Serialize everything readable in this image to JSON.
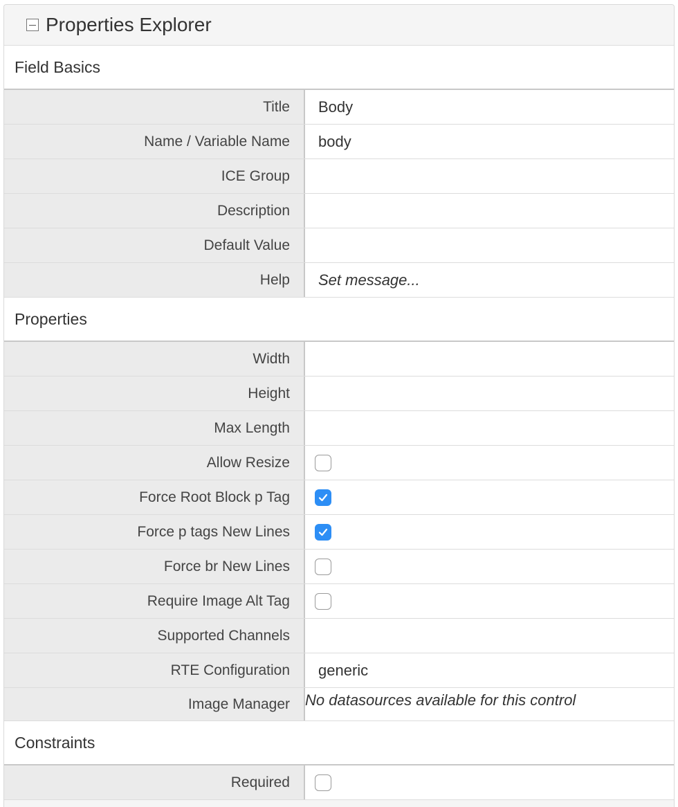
{
  "panel": {
    "title": "Properties Explorer"
  },
  "sections": {
    "field_basics": {
      "title": "Field Basics",
      "rows": [
        {
          "label": "Title",
          "value": "Body"
        },
        {
          "label": "Name / Variable Name",
          "value": "body"
        },
        {
          "label": "ICE Group",
          "value": ""
        },
        {
          "label": "Description",
          "value": ""
        },
        {
          "label": "Default Value",
          "value": ""
        },
        {
          "label": "Help",
          "value": "Set message..."
        }
      ]
    },
    "properties": {
      "title": "Properties",
      "rows": [
        {
          "label": "Width",
          "value": ""
        },
        {
          "label": "Height",
          "value": ""
        },
        {
          "label": "Max Length",
          "value": ""
        },
        {
          "label": "Allow Resize",
          "checked": false
        },
        {
          "label": "Force Root Block p Tag",
          "checked": true
        },
        {
          "label": "Force p tags New Lines",
          "checked": true
        },
        {
          "label": "Force br New Lines",
          "checked": false
        },
        {
          "label": "Require Image Alt Tag",
          "checked": false
        },
        {
          "label": "Supported Channels",
          "value": ""
        },
        {
          "label": "RTE Configuration",
          "value": "generic"
        },
        {
          "label": "Image Manager",
          "value": "No datasources available for this control"
        }
      ]
    },
    "constraints": {
      "title": "Constraints",
      "rows": [
        {
          "label": "Required",
          "checked": false
        }
      ]
    }
  },
  "colors": {
    "checkbox_checked": "#2d8ef5",
    "label_bg": "#ebebeb"
  }
}
